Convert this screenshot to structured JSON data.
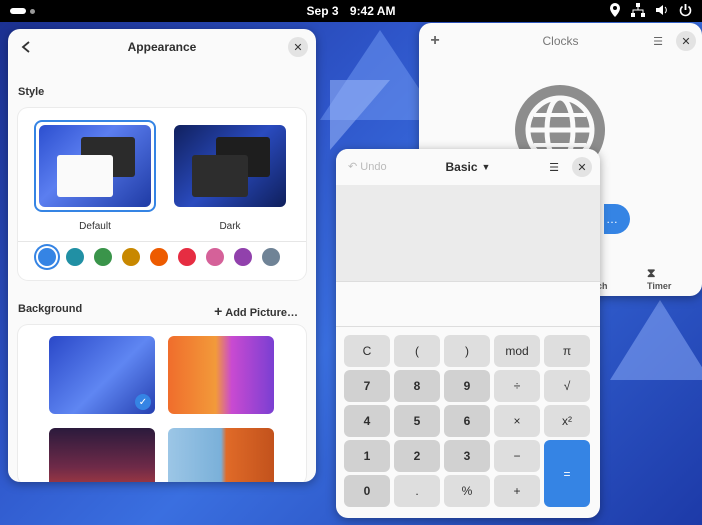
{
  "topbar": {
    "date": "Sep 3",
    "time": "9:42 AM"
  },
  "settings": {
    "title": "Appearance",
    "style_label": "Style",
    "style_options": [
      {
        "label": "Default",
        "selected": true
      },
      {
        "label": "Dark",
        "selected": false
      }
    ],
    "accent_colors": [
      "#3584e4",
      "#2190a4",
      "#3a944a",
      "#c88800",
      "#ed5b00",
      "#e62d42",
      "#d56199",
      "#9141ac",
      "#6f8396"
    ],
    "background_label": "Background",
    "add_picture_label": "Add Picture…"
  },
  "clocks": {
    "title": "Clocks",
    "tabs": [
      "tch",
      "Timer"
    ]
  },
  "calculator": {
    "undo_label": "Undo",
    "mode_label": "Basic",
    "keys": [
      [
        "C",
        "(",
        ")",
        "mod",
        "π"
      ],
      [
        "7",
        "8",
        "9",
        "÷",
        "√"
      ],
      [
        "4",
        "5",
        "6",
        "×",
        "x²"
      ],
      [
        "1",
        "2",
        "3",
        "−",
        "="
      ],
      [
        "0",
        ".",
        "%",
        "+"
      ]
    ]
  }
}
